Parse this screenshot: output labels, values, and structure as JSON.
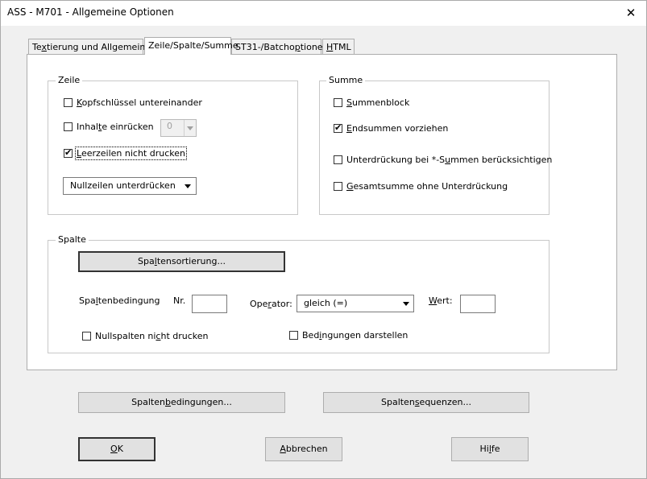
{
  "window": {
    "title": "ASS - M701 - Allgemeine Optionen",
    "close_glyph": "✕"
  },
  "tabs": [
    {
      "pre": "Te",
      "u": "x",
      "post": "tierung und Allgemeines"
    },
    {
      "pre": "Zeile/Spalte/Summe",
      "u": "",
      "post": ""
    },
    {
      "pre": "ST31-/Batcho",
      "u": "p",
      "post": "tionen"
    },
    {
      "pre": "",
      "u": "H",
      "post": "TML"
    }
  ],
  "active_tab": 1,
  "zeile": {
    "title": "Zeile",
    "kopf": {
      "pre": "",
      "u": "K",
      "post": "opfschlüssel untereinander",
      "checked": false
    },
    "inhalte": {
      "pre": "Inhal",
      "u": "t",
      "post": "e einrücken",
      "checked": false
    },
    "indent_value": "0",
    "leer": {
      "pre": "",
      "u": "L",
      "post": "eerzeilen nicht drucken",
      "checked": true
    },
    "nullzeilen_selected": "Nullzeilen unterdrücken"
  },
  "summe": {
    "title": "Summe",
    "block": {
      "pre": "",
      "u": "S",
      "post": "ummenblock",
      "checked": false
    },
    "end": {
      "pre": "",
      "u": "E",
      "post": "ndsummen vorziehen",
      "checked": true
    },
    "unter": {
      "pre": "Unterdrückung bei *-S",
      "u": "u",
      "post": "mmen berücksichtigen",
      "checked": false
    },
    "gesamt": {
      "pre": "",
      "u": "G",
      "post": "esamtsumme ohne Unterdrückung",
      "checked": false
    }
  },
  "spalte": {
    "title": "Spalte",
    "sort_button": {
      "pre": "Spa",
      "u": "l",
      "post": "tensortierung..."
    },
    "bedingung": {
      "pre": "Spa",
      "u": "l",
      "post": "tenbedingung"
    },
    "nr_label": "Nr.",
    "nr_value": "",
    "operator_label": {
      "pre": "Ope",
      "u": "r",
      "post": "ator:"
    },
    "operator_selected": "gleich (=)",
    "wert_label": {
      "pre": "",
      "u": "W",
      "post": "ert:"
    },
    "wert_value": "",
    "nullspalten": {
      "pre": "Nullspalten ni",
      "u": "c",
      "post": "ht drucken",
      "checked": false
    },
    "bedingungen_darstellen": {
      "pre": "Bed",
      "u": "i",
      "post": "ngungen darstellen",
      "checked": false
    }
  },
  "buttons": {
    "spaltenbedingungen": {
      "pre": "Spalten",
      "u": "b",
      "post": "edingungen..."
    },
    "spaltensequenzen": {
      "pre": "Spalten",
      "u": "s",
      "post": "equenzen..."
    },
    "ok": {
      "pre": "",
      "u": "O",
      "post": "K"
    },
    "abbrechen": {
      "pre": "",
      "u": "A",
      "post": "bbrechen"
    },
    "hilfe": {
      "pre": "Hi",
      "u": "l",
      "post": "fe"
    }
  }
}
